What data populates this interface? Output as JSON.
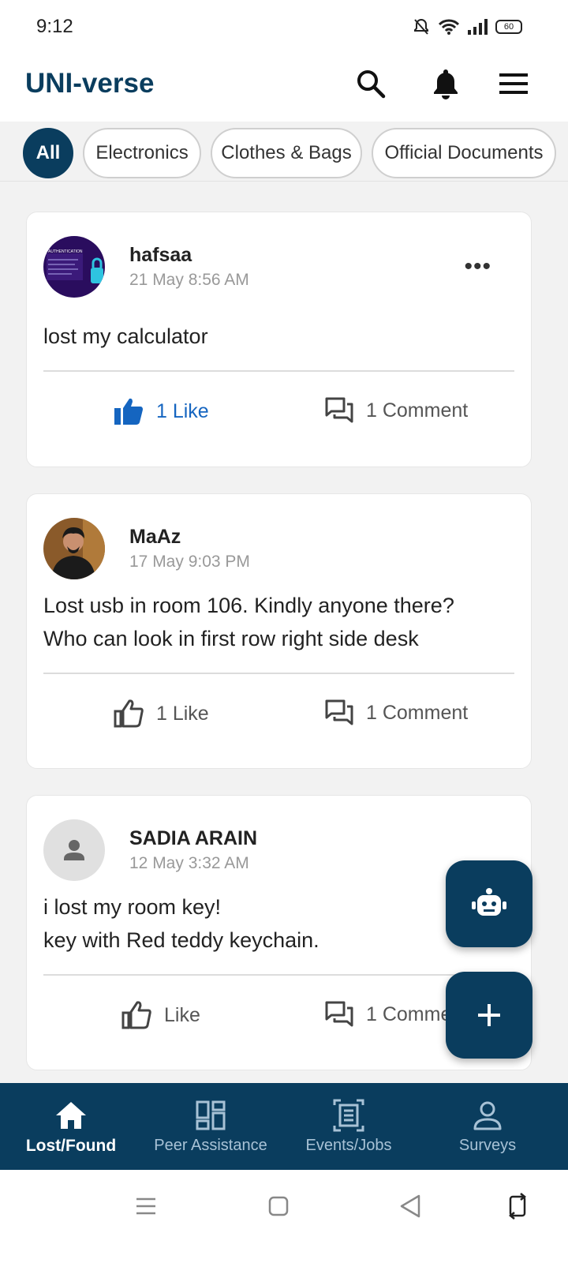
{
  "status": {
    "time": "9:12",
    "battery": "60"
  },
  "app": {
    "title": "UNI-verse"
  },
  "filters": [
    "All",
    "Electronics",
    "Clothes & Bags",
    "Official Documents"
  ],
  "posts": [
    {
      "user": "hafsaa",
      "date": "21 May 8:56 AM",
      "text": "lost my calculator",
      "like_label": "1 Like",
      "comment_label": "1 Comment",
      "liked": true
    },
    {
      "user": "MaAz",
      "date": "17 May 9:03 PM",
      "text": "Lost usb in room 106. Kindly anyone there?\nWho can look in first row right side desk",
      "like_label": "1 Like",
      "comment_label": "1 Comment",
      "liked": false
    },
    {
      "user": "SADIA ARAIN",
      "date": "12 May 3:32 AM",
      "text": "i lost my room key!\nkey with Red teddy keychain.",
      "like_label": "Like",
      "comment_label": "1 Comment",
      "liked": false
    }
  ],
  "avatar_thumbnail": {
    "heading": "AUTHENTICATION"
  },
  "bottom_nav": [
    "Lost/Found",
    "Peer Assistance",
    "Events/Jobs",
    "Surveys"
  ],
  "colors": {
    "primary": "#0a3d5e",
    "liked": "#1565c0"
  },
  "icons": [
    "search-icon",
    "bell-icon",
    "menu-icon",
    "like-icon",
    "comment-icon",
    "robot-icon",
    "plus-icon",
    "home-icon",
    "dashboard-icon",
    "document-icon",
    "person-icon"
  ]
}
